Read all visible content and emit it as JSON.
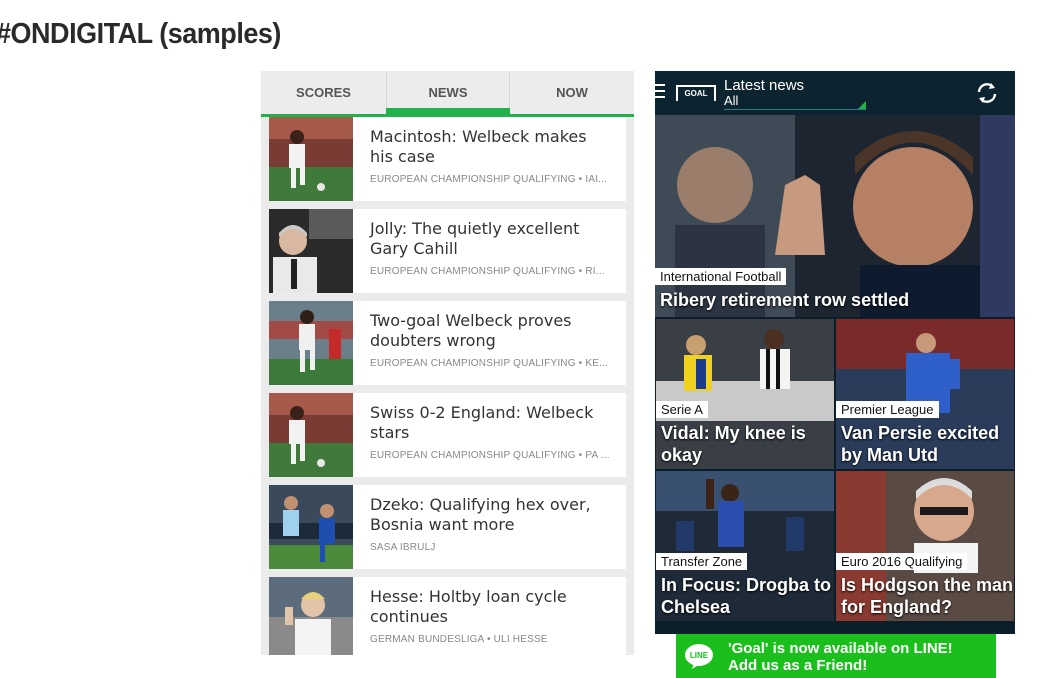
{
  "page": {
    "title": "#ONDIGITAL (samples)"
  },
  "left_app": {
    "tabs": [
      {
        "label": "SCORES",
        "active": false
      },
      {
        "label": "NEWS",
        "active": true
      },
      {
        "label": "NOW",
        "active": false
      }
    ],
    "accent_color": "#22b24c",
    "articles": [
      {
        "title": "Macintosh: Welbeck makes his case",
        "meta": "EUROPEAN CHAMPIONSHIP QUALIFYING • IAI..."
      },
      {
        "title": "Jolly: The quietly excellent Gary Cahill",
        "meta": "EUROPEAN CHAMPIONSHIP QUALIFYING • RI..."
      },
      {
        "title": "Two-goal Welbeck proves doubters wrong",
        "meta": "EUROPEAN CHAMPIONSHIP QUALIFYING • KE..."
      },
      {
        "title": "Swiss 0-2 England: Welbeck stars",
        "meta": "EUROPEAN CHAMPIONSHIP QUALIFYING • PA ..."
      },
      {
        "title": "Dzeko: Qualifying hex over, Bosnia want more",
        "meta": "SASA IBRULJ"
      },
      {
        "title": "Hesse: Holtby loan cycle continues",
        "meta": "GERMAN BUNDESLIGA • ULI HESSE"
      }
    ]
  },
  "right_app": {
    "logo_text": "GOAL",
    "header_title": "Latest news",
    "header_filter": "All",
    "hero": {
      "category": "International Football",
      "title": "Ribery retirement row settled"
    },
    "tiles": [
      {
        "category": "Serie A",
        "title": "Vidal: My knee is okay"
      },
      {
        "category": "Premier League",
        "title": "Van Persie excited by Man Utd signings"
      },
      {
        "category": "Transfer Zone",
        "title": "In Focus: Drogba to Chelsea"
      },
      {
        "category": "Euro 2016 Qualifying",
        "title": "Is Hodgson the man for England?"
      }
    ],
    "banner": {
      "logo_text": "LINE",
      "line1": "'Goal' is now available on LINE!",
      "line2": "Add us as a Friend!"
    }
  }
}
